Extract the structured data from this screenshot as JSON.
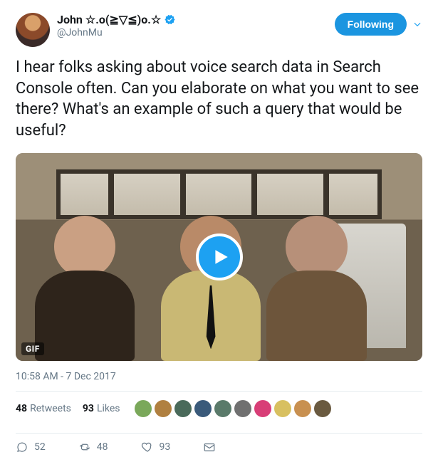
{
  "user": {
    "display_name": "John ☆.o(≧▽≦)o.☆",
    "handle": "@JohnMu",
    "verified": true
  },
  "follow": {
    "label": "Following"
  },
  "tweet_text": "I hear folks asking about voice search data in Search Console often. Can you elaborate on what you want to see there? What's an example of such a query that would be useful?",
  "media": {
    "gif_badge": "GIF"
  },
  "timestamp": "10:58 AM - 7 Dec 2017",
  "stats": {
    "retweets_count": "48",
    "retweets_label": "Retweets",
    "likes_count": "93",
    "likes_label": "Likes"
  },
  "liker_colors": [
    "#7aa85a",
    "#b08040",
    "#4a6a5a",
    "#3a5a7a",
    "#5a7a6a",
    "#707070",
    "#d83e77",
    "#d8c060",
    "#c89050",
    "#6a5a40"
  ],
  "actions": {
    "replies": "52",
    "retweets": "48",
    "likes": "93"
  }
}
